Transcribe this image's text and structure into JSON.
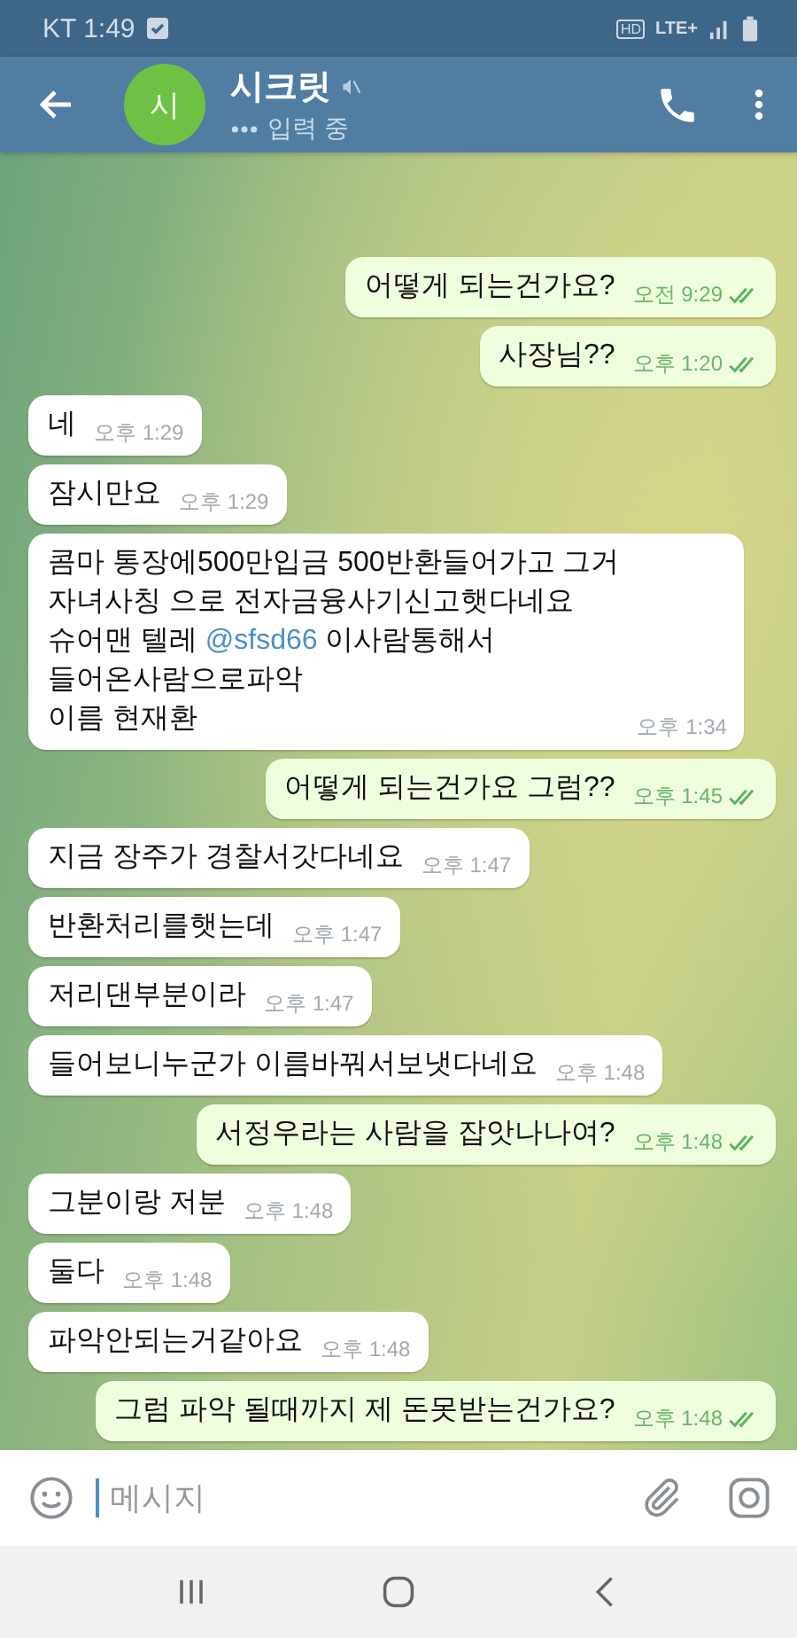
{
  "status_bar": {
    "carrier_time": "KT 1:49",
    "hd": "HD",
    "network": "LTE+"
  },
  "header": {
    "avatar_letter": "시",
    "title": "시크릿",
    "muted": true,
    "subtitle": "입력 중"
  },
  "messages": [
    {
      "kind": "out",
      "text": "어떻게 되는건가요?",
      "time": "오전 9:29",
      "read": true
    },
    {
      "kind": "out",
      "text": "사장님??",
      "time": "오후 1:20",
      "read": true
    },
    {
      "kind": "in",
      "text": "네",
      "time": "오후 1:29"
    },
    {
      "kind": "in",
      "text": "잠시만요",
      "time": "오후 1:29"
    },
    {
      "kind": "in",
      "parts": [
        {
          "kind": "text",
          "text": "콤마 통장에500만입금 500반환들어가고 그거\n자녀사칭 으로 전자금융사기신고햇다네요\n슈어맨 텔레 "
        },
        {
          "kind": "mention",
          "text": "@sfsd66"
        },
        {
          "kind": "text",
          "text": " 이사람통해서\n들어온사람으로파악\n이름 현재환"
        }
      ],
      "time": "오후 1:34"
    },
    {
      "kind": "out",
      "text": "어떻게 되는건가요 그럼??",
      "time": "오후 1:45",
      "read": true
    },
    {
      "kind": "in",
      "text": "지금 장주가 경찰서갓다네요",
      "time": "오후 1:47"
    },
    {
      "kind": "in",
      "text": "반환처리를햇는데",
      "time": "오후 1:47"
    },
    {
      "kind": "in",
      "text": "저리댄부분이라",
      "time": "오후 1:47"
    },
    {
      "kind": "in",
      "text": "들어보니누군가 이름바꿔서보냇다네요",
      "time": "오후 1:48"
    },
    {
      "kind": "out",
      "text": "서정우라는 사람을 잡앗나나여?",
      "time": "오후 1:48",
      "read": true
    },
    {
      "kind": "in",
      "text": "그분이랑 저분",
      "time": "오후 1:48"
    },
    {
      "kind": "in",
      "text": "둘다",
      "time": "오후 1:48"
    },
    {
      "kind": "in",
      "text": "파악안되는거같아요",
      "time": "오후 1:48"
    },
    {
      "kind": "out",
      "text": "그럼 파악 될때까지 제 돈못받는건가요?",
      "time": "오후 1:48",
      "read": true
    }
  ],
  "composer": {
    "placeholder": "메시지"
  }
}
